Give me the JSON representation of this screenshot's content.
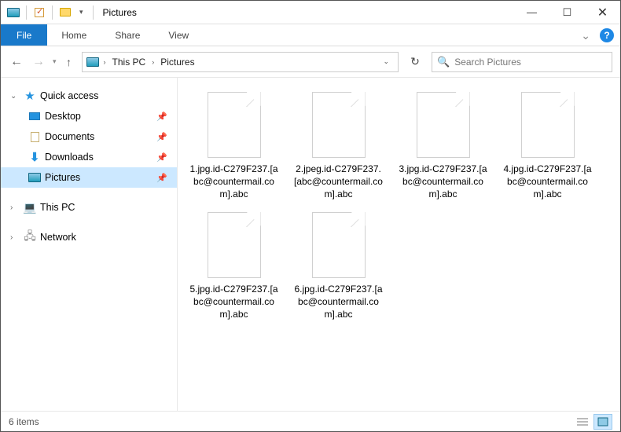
{
  "title": "Pictures",
  "ribbon": {
    "file": "File",
    "tabs": [
      "Home",
      "Share",
      "View"
    ]
  },
  "breadcrumb": {
    "segments": [
      "This PC",
      "Pictures"
    ]
  },
  "search": {
    "placeholder": "Search Pictures"
  },
  "sidebar": {
    "quick_access": "Quick access",
    "items": [
      {
        "label": "Desktop",
        "icon": "desktop"
      },
      {
        "label": "Documents",
        "icon": "doc"
      },
      {
        "label": "Downloads",
        "icon": "down"
      },
      {
        "label": "Pictures",
        "icon": "pictures",
        "selected": true
      }
    ],
    "this_pc": "This PC",
    "network": "Network"
  },
  "files": [
    "1.jpg.id-C279F237.[abc@countermail.com].abc",
    "2.jpeg.id-C279F237.[abc@countermail.com].abc",
    "3.jpg.id-C279F237.[abc@countermail.com].abc",
    "4.jpg.id-C279F237.[abc@countermail.com].abc",
    "5.jpg.id-C279F237.[abc@countermail.com].abc",
    "6.jpg.id-C279F237.[abc@countermail.com].abc"
  ],
  "status": {
    "count": "6 items"
  }
}
